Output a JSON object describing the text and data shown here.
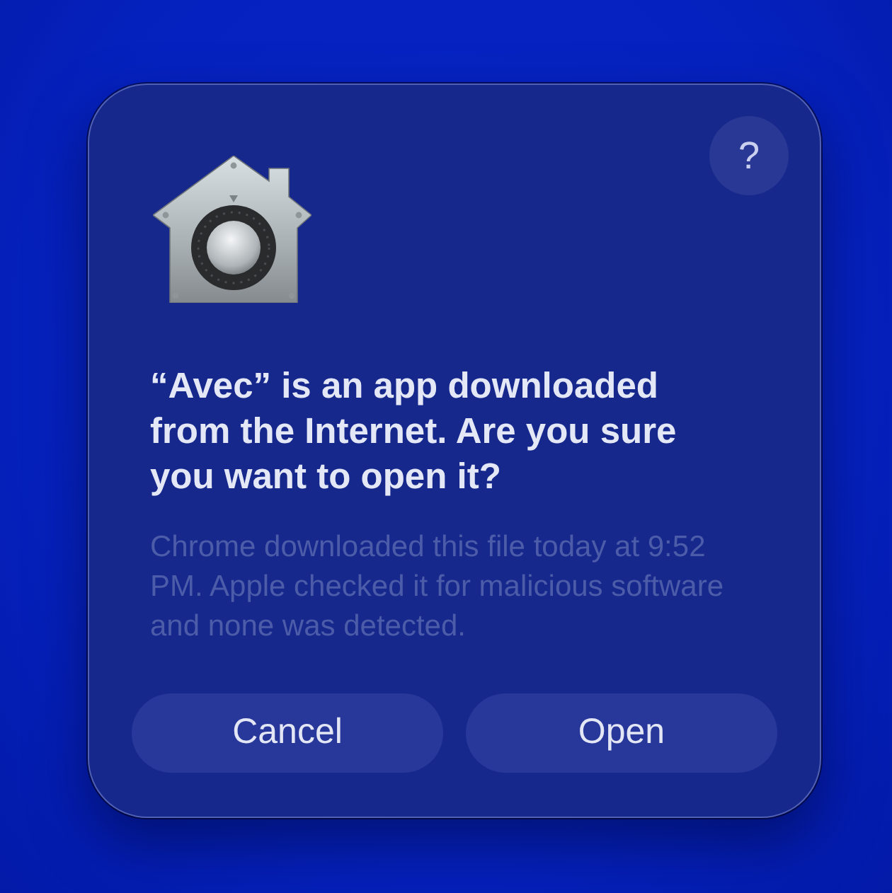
{
  "dialog": {
    "help_button": {
      "label": "?"
    },
    "title": "“Avec” is an app downloaded from the Internet. Are you sure you want to open it?",
    "message": "Chrome downloaded this file today at 9:52 PM. Apple checked it for malicious software and none was detected.",
    "buttons": [
      {
        "label": "Cancel"
      },
      {
        "label": "Open"
      }
    ]
  }
}
